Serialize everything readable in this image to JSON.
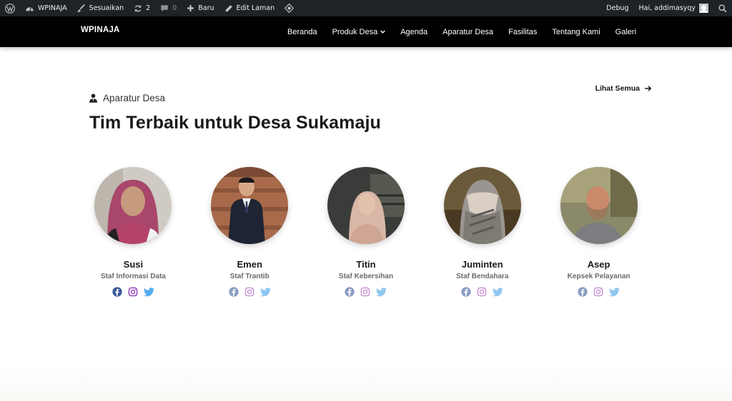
{
  "adminbar": {
    "site_name": "WPINAJA",
    "customize": "Sesuaikan",
    "updates_count": "2",
    "comments_count": "0",
    "new_label": "Baru",
    "edit_label": "Edit Laman",
    "debug_label": "Debug",
    "greeting": "Hai, addimasyqy"
  },
  "header": {
    "logo": "WPINAJA",
    "nav": [
      "Beranda",
      "Produk Desa",
      "Agenda",
      "Aparatur Desa",
      "Fasilitas",
      "Tentang Kami",
      "Galeri"
    ]
  },
  "section": {
    "eyebrow": "Aparatur Desa",
    "title": "Tim Terbaik untuk Desa Sukamaju",
    "see_all": "Lihat Semua"
  },
  "team": [
    {
      "name": "Susi",
      "role": "Staf Informasi Data"
    },
    {
      "name": "Emen",
      "role": "Staf Trantib"
    },
    {
      "name": "Titin",
      "role": "Staf Kebersihan"
    },
    {
      "name": "Juminten",
      "role": "Staf Bendahara"
    },
    {
      "name": "Asep",
      "role": "Kepsek Pelayanan"
    }
  ],
  "colors": {
    "facebook_active": "#3b5998",
    "instagram_active": "#8a3ab9",
    "twitter": "#55acee",
    "facebook_muted": "#8b9dc3",
    "instagram_muted": "#c490d1"
  }
}
